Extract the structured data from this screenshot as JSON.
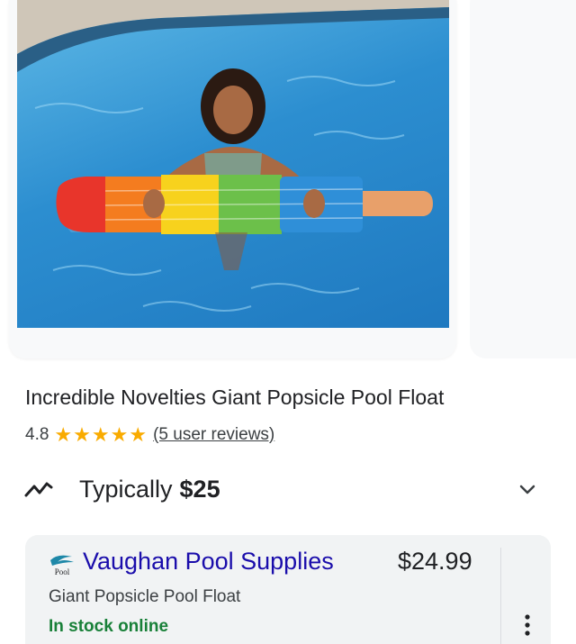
{
  "product": {
    "title": "Incredible Novelties Giant Popsicle Pool Float",
    "rating": "4.8",
    "stars": 5,
    "reviews_label": "(5 user reviews)"
  },
  "typical_price": {
    "label": "Typically",
    "value": "$25",
    "icon": "trend-icon"
  },
  "offer": {
    "seller": "Vaughan Pool Supplies",
    "logo_text": "Pool",
    "price": "$24.99",
    "product_name": "Giant Popsicle Pool Float",
    "stock_status": "In stock online",
    "stock_color": "#188038",
    "seller_color": "#1a0dab"
  },
  "colors": {
    "star": "#f9ab00",
    "card_bg": "#f1f3f4"
  }
}
